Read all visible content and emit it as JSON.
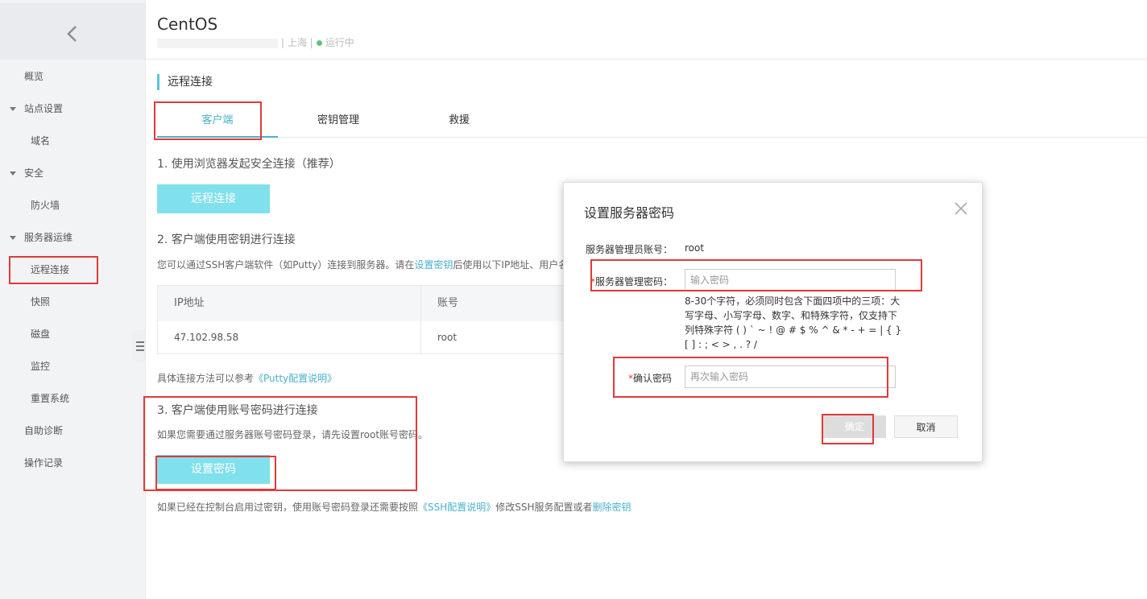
{
  "sidebar": {
    "items": [
      {
        "label": "概览"
      },
      {
        "label": "站点设置"
      },
      {
        "label": "域名"
      },
      {
        "label": "安全"
      },
      {
        "label": "防火墙"
      },
      {
        "label": "服务器运维"
      },
      {
        "label": "远程连接"
      },
      {
        "label": "快照"
      },
      {
        "label": "磁盘"
      },
      {
        "label": "监控"
      },
      {
        "label": "重置系统"
      },
      {
        "label": "自助诊断"
      },
      {
        "label": "操作记录"
      }
    ]
  },
  "header": {
    "title": "CentOS",
    "region": "| 上海 |",
    "status": "运行中",
    "status_color": "#5cc47a"
  },
  "section_title": "远程连接",
  "tabs": [
    {
      "label": "客户端",
      "active": true
    },
    {
      "label": "密钥管理",
      "active": false
    },
    {
      "label": "救援",
      "active": false
    }
  ],
  "step1": {
    "title": "1. 使用浏览器发起安全连接（推荐）",
    "button": "远程连接"
  },
  "step2": {
    "title": "2. 客户端使用密钥进行连接",
    "desc_before": "您可以通过SSH客户端软件（如Putty）连接到服务器。请在",
    "desc_link": "设置密钥",
    "desc_after": "后使用以下IP地址、用户名",
    "table": {
      "headers": [
        "IP地址",
        "账号"
      ],
      "rows": [
        [
          "47.102.98.58",
          "root"
        ]
      ]
    },
    "ref_text": "具体连接方法可以参考",
    "ref_link": "《Putty配置说明》"
  },
  "step3": {
    "title": "3. 客户端使用账号密码进行连接",
    "desc": "如果您需要通过服务器账号密码登录，请先设置root账号密码。",
    "button": "设置密码",
    "note_before": "如果已经在控制台启用过密钥，使用账号密码登录还需要按照",
    "note_link1": "《SSH配置说明》",
    "note_middle": "修改SSH服务配置或者",
    "note_link2": "删除密钥"
  },
  "dialog": {
    "title": "设置服务器密码",
    "account_label": "服务器管理员账号：",
    "account_value": "root",
    "password_label": "服务器管理密码：",
    "password_placeholder": "输入密码",
    "hint": "8-30个字符，必须同时包含下面四项中的三项：大写字母、小写字母、数字、和特殊字符，仅支持下列特殊字符 ( ) ` ~ ! @ # $ % ^ & * - + = | { } [ ] : ; < > , . ? /",
    "confirm_label": "确认密码",
    "confirm_placeholder": "再次输入密码",
    "ok": "确定",
    "cancel": "取消"
  },
  "colors": {
    "accent": "#4ab0cb",
    "button": "#80e0ec",
    "highlight": "#e03a3a"
  }
}
